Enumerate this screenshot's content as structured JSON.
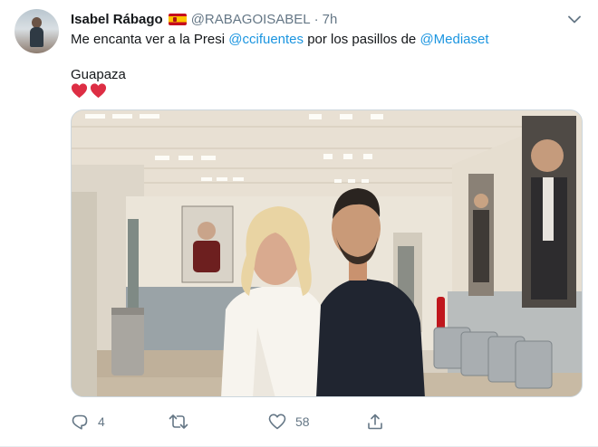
{
  "tweet": {
    "author_name": "Isabel Rábago",
    "author_flag": "spain-flag-icon",
    "handle": "@RABAGOISABEL",
    "separator": "·",
    "time": "7h",
    "text_prefix": "Me encanta ver a la Presi ",
    "mention1": "@ccifuentes",
    "text_middle": " por los pasillos de ",
    "mention2": "@Mediaset",
    "second_line": "Guapaza",
    "emojis": [
      "red-heart-icon",
      "red-heart-icon"
    ]
  },
  "actions": {
    "reply_count": "4",
    "retweet_count": "",
    "like_count": "58",
    "share_count": ""
  },
  "colors": {
    "link": "#1b95e0",
    "muted": "#657786",
    "heart": "#e0245e"
  }
}
